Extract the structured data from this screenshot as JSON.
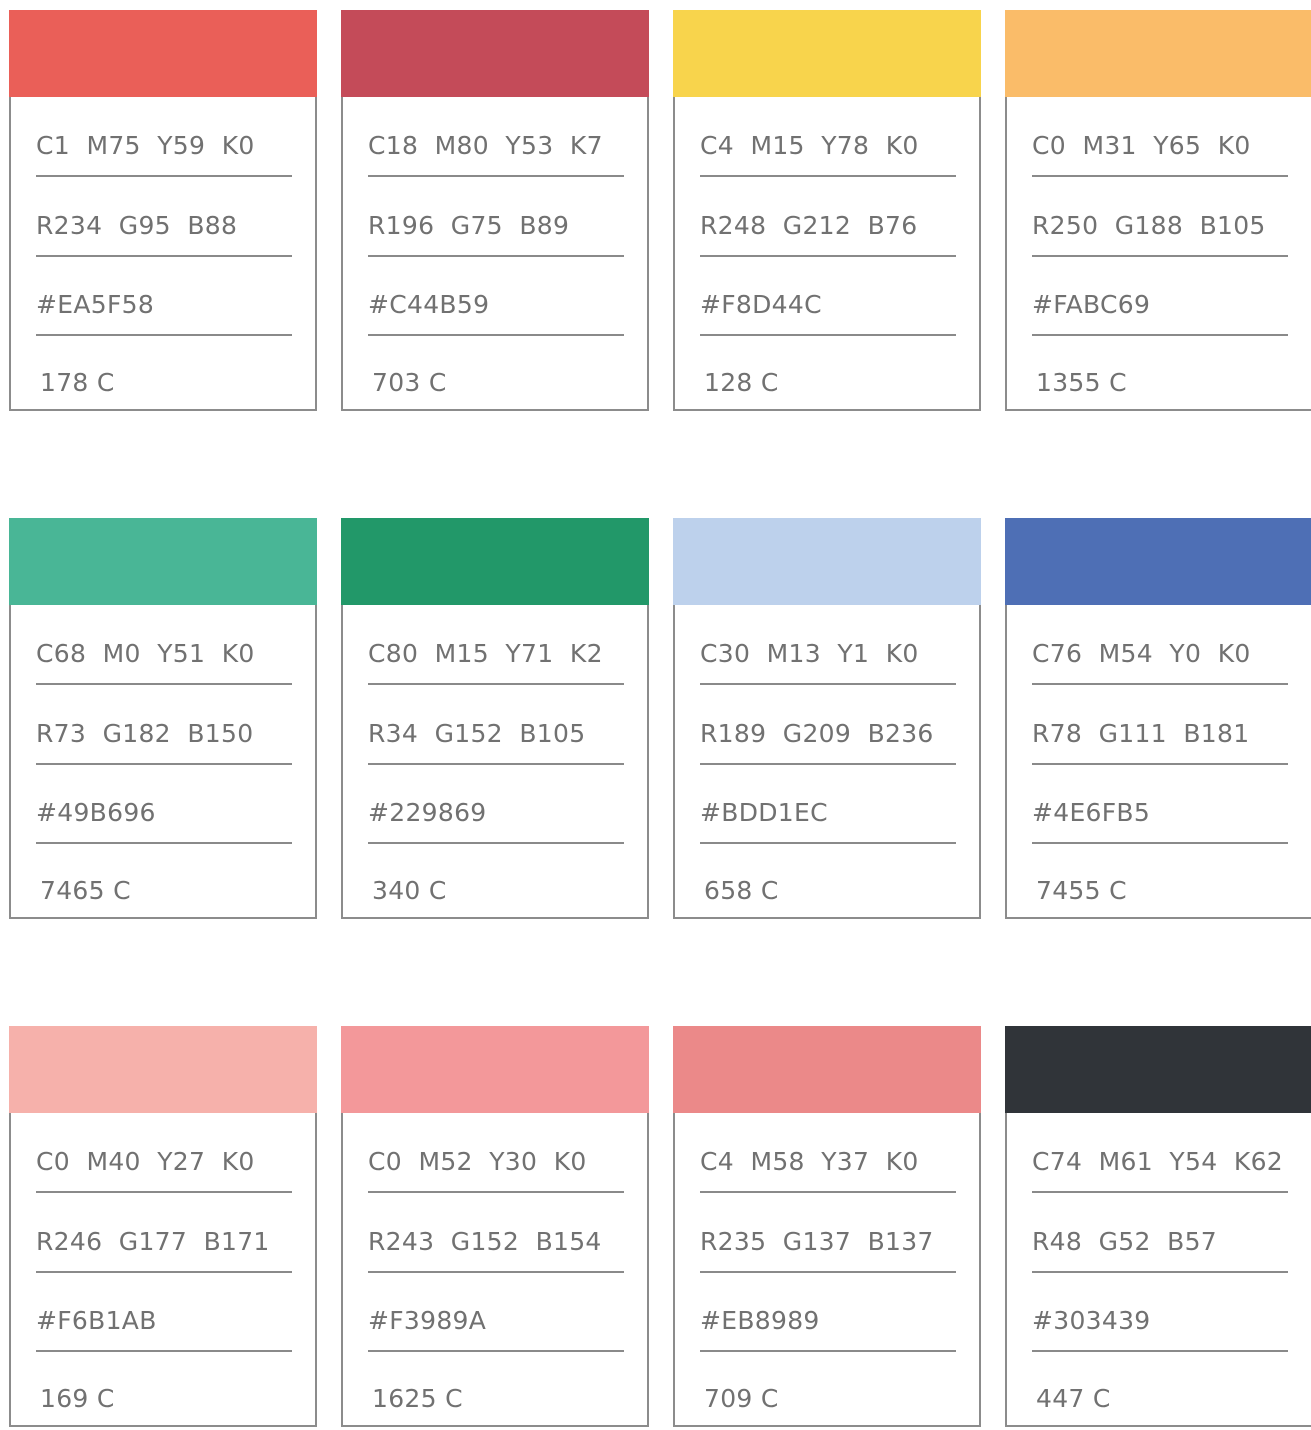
{
  "swatches": [
    {
      "color": "#EA5F58",
      "cmyk": "C1  M75  Y59  K0",
      "rgb": "R234  G95  B88",
      "hex": "#EA5F58",
      "pantone": "178 C"
    },
    {
      "color": "#C44B59",
      "cmyk": "C18  M80  Y53  K7",
      "rgb": "R196  G75  B89",
      "hex": "#C44B59",
      "pantone": "703 C"
    },
    {
      "color": "#F8D44C",
      "cmyk": "C4  M15  Y78  K0",
      "rgb": "R248  G212  B76",
      "hex": "#F8D44C",
      "pantone": "128 C"
    },
    {
      "color": "#FABC69",
      "cmyk": "C0  M31  Y65  K0",
      "rgb": "R250  G188  B105",
      "hex": "#FABC69",
      "pantone": "1355 C"
    },
    {
      "color": "#49B696",
      "cmyk": "C68  M0  Y51  K0",
      "rgb": "R73  G182  B150",
      "hex": "#49B696",
      "pantone": "7465 C"
    },
    {
      "color": "#229869",
      "cmyk": "C80  M15  Y71  K2",
      "rgb": "R34  G152  B105",
      "hex": "#229869",
      "pantone": "340 C"
    },
    {
      "color": "#BDD1EC",
      "cmyk": "C30  M13  Y1  K0",
      "rgb": "R189  G209  B236",
      "hex": "#BDD1EC",
      "pantone": "658 C"
    },
    {
      "color": "#4E6FB5",
      "cmyk": "C76  M54  Y0  K0",
      "rgb": "R78  G111  B181",
      "hex": "#4E6FB5",
      "pantone": "7455 C"
    },
    {
      "color": "#F6B1AB",
      "cmyk": "C0  M40  Y27  K0",
      "rgb": "R246  G177  B171",
      "hex": "#F6B1AB",
      "pantone": "169 C"
    },
    {
      "color": "#F3989A",
      "cmyk": "C0  M52  Y30  K0",
      "rgb": "R243  G152  B154",
      "hex": "#F3989A",
      "pantone": "1625 C"
    },
    {
      "color": "#EB8989",
      "cmyk": "C4  M58  Y37  K0",
      "rgb": "R235  G137  B137",
      "hex": "#EB8989",
      "pantone": "709 C"
    },
    {
      "color": "#303439",
      "cmyk": "C74  M61  Y54  K62",
      "rgb": "R48  G52  B57",
      "hex": "#303439",
      "pantone": "447 C"
    }
  ]
}
